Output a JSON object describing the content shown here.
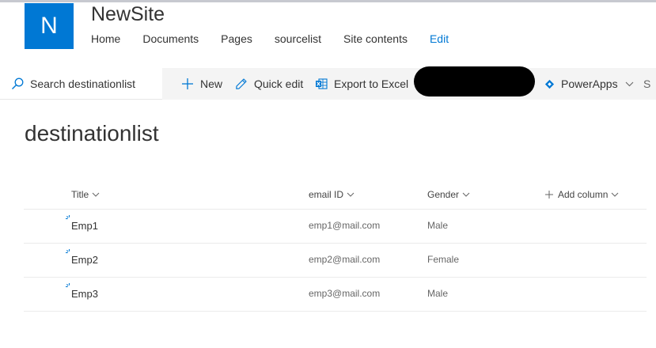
{
  "site": {
    "logo_letter": "N",
    "title": "NewSite",
    "nav": [
      "Home",
      "Documents",
      "Pages",
      "sourcelist",
      "Site contents"
    ],
    "edit_label": "Edit"
  },
  "command_bar": {
    "search_label": "Search destinationlist",
    "new_label": "New",
    "quick_edit_label": "Quick edit",
    "export_label": "Export to Excel",
    "powerapps_label": "PowerApps",
    "overflow_label": "S"
  },
  "list": {
    "title": "destinationlist",
    "columns": [
      {
        "label": "Title"
      },
      {
        "label": "email ID"
      },
      {
        "label": "Gender"
      }
    ],
    "add_column_label": "Add column",
    "rows": [
      {
        "title": "Emp1",
        "email": "emp1@mail.com",
        "gender": "Male"
      },
      {
        "title": "Emp2",
        "email": "emp2@mail.com",
        "gender": "Female"
      },
      {
        "title": "Emp3",
        "email": "emp3@mail.com",
        "gender": "Male"
      }
    ]
  },
  "colors": {
    "accent": "#0078d4",
    "command_bar_bg": "#f4f4f4",
    "redaction": "#000000"
  },
  "icons": {
    "search": "search-icon",
    "new": "plus-icon",
    "quick_edit": "pencil-icon",
    "export": "excel-icon",
    "powerapps": "powerapps-icon",
    "new_item": "new-item-sparkle-icon"
  }
}
